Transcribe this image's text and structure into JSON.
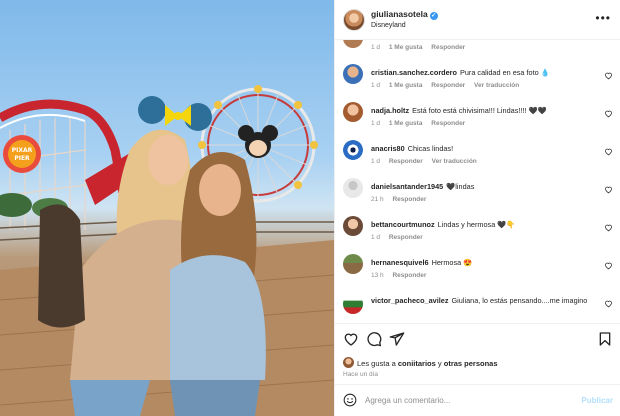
{
  "post": {
    "username": "giulianasotela",
    "verified_mark": "✓",
    "location": "Disneyland",
    "more_icon": "more-horizontal-icon"
  },
  "comments": [
    {
      "user": "",
      "text": "",
      "time": "1 d",
      "likes": "1 Me gusta",
      "reply": "Responder",
      "translate": ""
    },
    {
      "user": "cristian.sanchez.cordero",
      "text": "Pura calidad en esa foto 💧",
      "time": "1 d",
      "likes": "1 Me gusta",
      "reply": "Responder",
      "translate": "Ver traducción"
    },
    {
      "user": "nadja.holtz",
      "text": "Está foto está chivisima!!! Lindas!!!! 🖤🖤",
      "time": "1 d",
      "likes": "1 Me gusta",
      "reply": "Responder",
      "translate": ""
    },
    {
      "user": "anacris80",
      "text": "Chicas lindas!",
      "time": "1 d",
      "likes": "",
      "reply": "Responder",
      "translate": "Ver traducción"
    },
    {
      "user": "danielsantander1945",
      "text": "🖤lindas",
      "time": "21 h",
      "likes": "",
      "reply": "Responder",
      "translate": ""
    },
    {
      "user": "bettancourtmunoz",
      "text": "Lindas y hermosa 🖤👇",
      "time": "1 d",
      "likes": "",
      "reply": "Responder",
      "translate": ""
    },
    {
      "user": "hernanesquivel6",
      "text": "Hermosa 😍",
      "time": "13 h",
      "likes": "",
      "reply": "Responder",
      "translate": ""
    },
    {
      "user": "victor_pacheco_avilez",
      "text": "Giuliana, lo estás pensando....me imagino",
      "time": "",
      "likes": "",
      "reply": "",
      "translate": ""
    }
  ],
  "actions": {
    "like_icon": "heart-icon",
    "comment_icon": "comment-icon",
    "share_icon": "share-icon",
    "save_icon": "bookmark-icon"
  },
  "likes_summary": {
    "prefix": "Les gusta a ",
    "user": "coniitarios",
    "suffix": " y ",
    "others": "otras personas"
  },
  "time_ago": "Hace un día",
  "comment_input": {
    "placeholder": "Agrega un comentario...",
    "value": "",
    "publish_label": "Publicar",
    "emoji_icon": "smiley-icon"
  },
  "colors": {
    "accent": "#3897f0",
    "publish_disabled": "#b2dffc",
    "meta": "#8e8e8e",
    "text": "#262626"
  }
}
